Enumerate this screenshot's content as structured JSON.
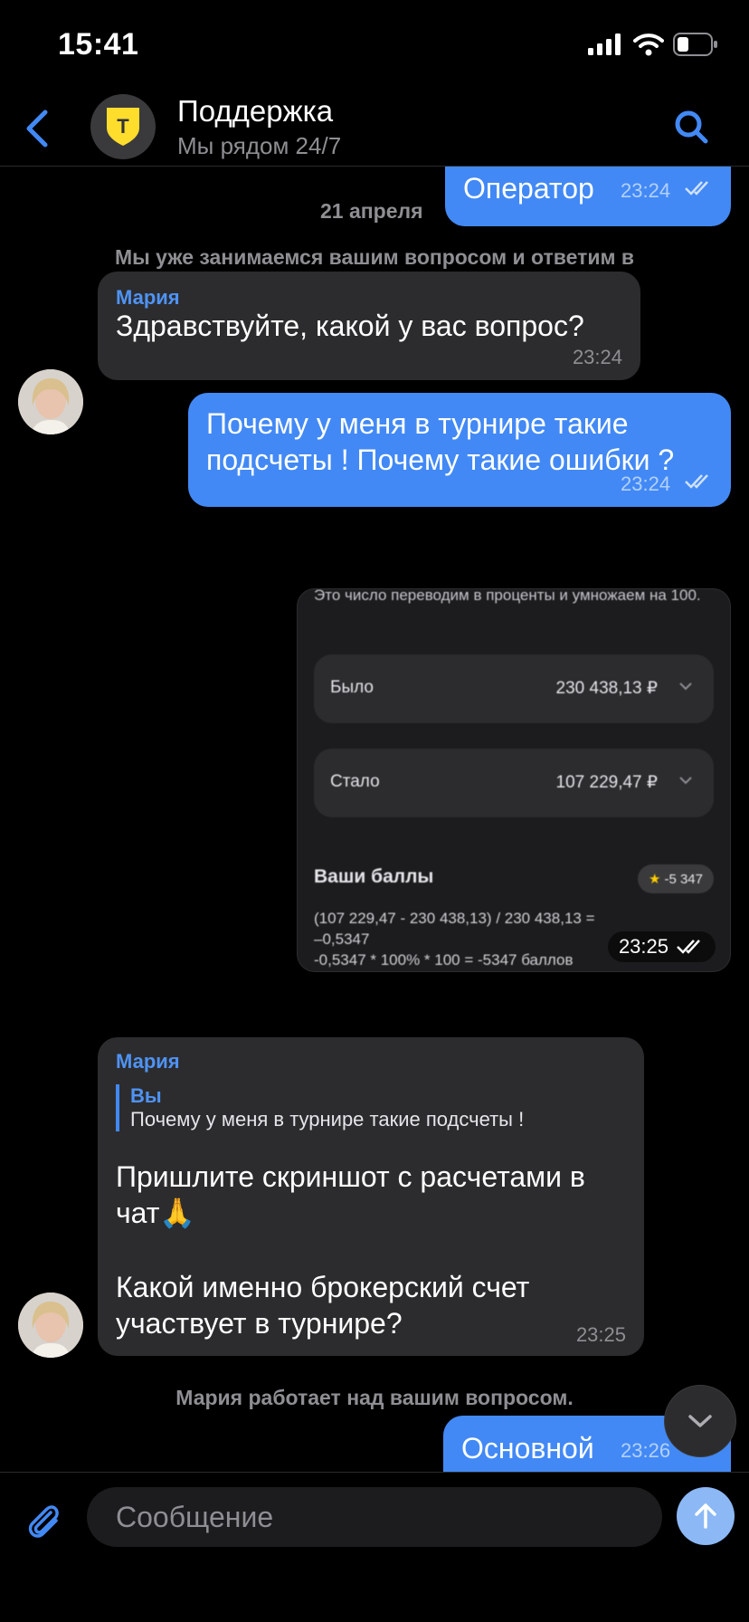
{
  "status_bar": {
    "time": "15:41"
  },
  "header": {
    "title": "Поддержка",
    "subtitle": "Мы рядом 24/7",
    "logo_letter": "T"
  },
  "colors": {
    "accent": "#4289f5",
    "bubble_in": "#2c2c2e",
    "background": "#000000"
  },
  "chat": {
    "date": "21 апреля",
    "sys_msg_1": "Мы уже занимаемся вашим вопросом и ответим в ближайшее время.",
    "sys_msg_2": "Мария работает над вашим вопросом.",
    "messages": [
      {
        "text": "Оператор",
        "time": "23:24"
      },
      {
        "sender": "Мария",
        "text": "Здравствуйте, какой у вас вопрос?",
        "time": "23:24"
      },
      {
        "text": "Почему у меня в турнире такие подсчеты ! Почему такие ошибки ?",
        "time": "23:24"
      },
      {
        "time": "23:25"
      },
      {
        "sender": "Мария",
        "reply_author": "Вы",
        "reply_text": "Почему у меня в турнире такие подсчеты !",
        "text_1": "Пришлите скриншот с расчетами в чат🙏",
        "text_2": "Какой именно брокерский счет участвует в турнире?",
        "time": "23:25"
      },
      {
        "text": "Основной",
        "time": "23:26"
      }
    ],
    "image": {
      "top_text": "Это число переводим в проценты и умножаем на 100.",
      "row1_label": "Было",
      "row1_value": "230 438,13 ₽",
      "row2_label": "Стало",
      "row2_value": "107 229,47 ₽",
      "score_title": "Ваши баллы",
      "badge": "-5 347",
      "formula_1": "(107 229,47 - 230 438,13) / 230 438,13 =",
      "formula_2": "–0,5347",
      "formula_3": "-0,5347 * 100% * 100 = -5347 баллов"
    }
  },
  "input": {
    "placeholder": "Сообщение"
  }
}
